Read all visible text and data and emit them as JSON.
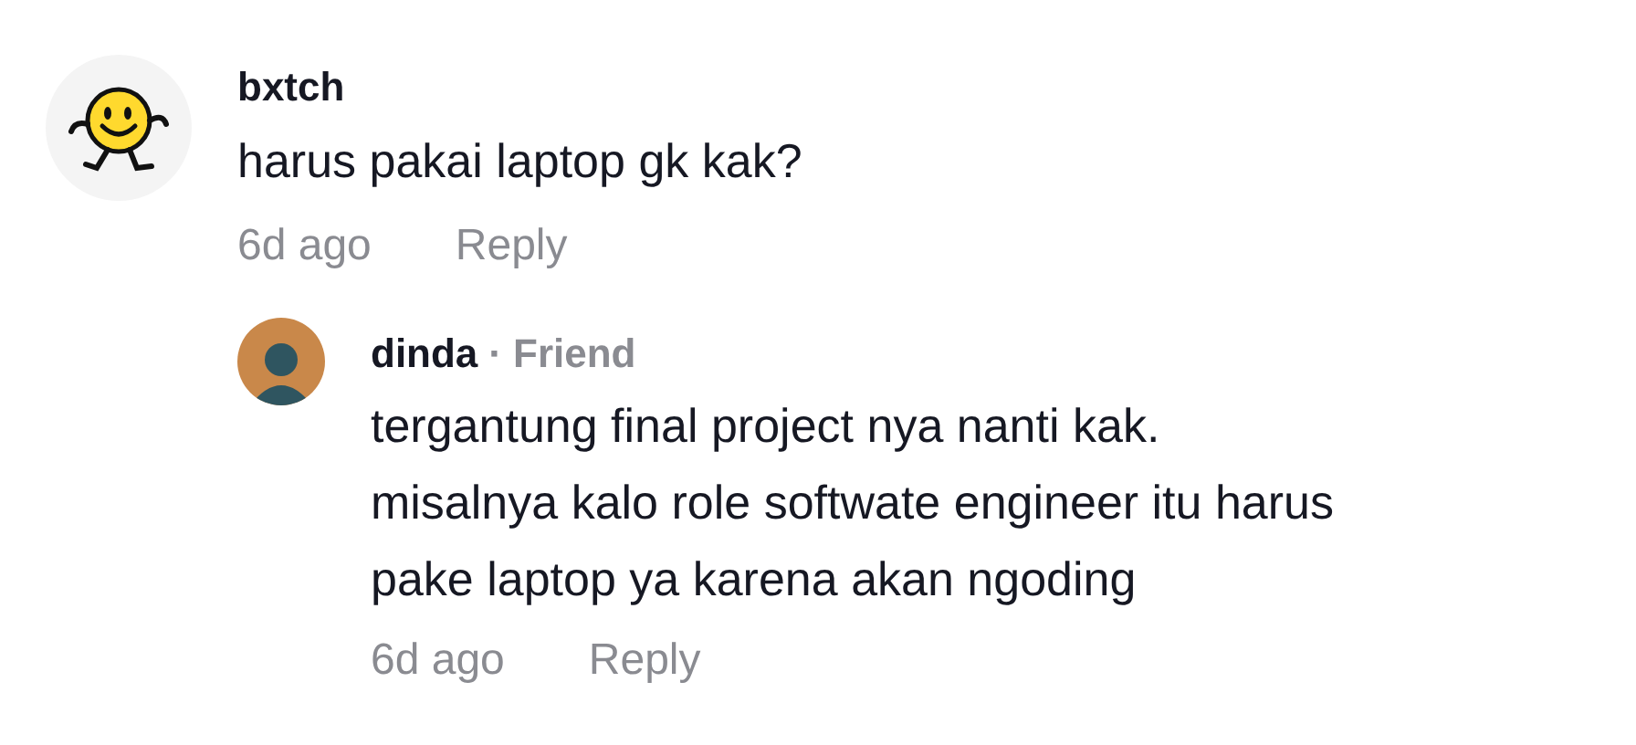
{
  "comments": [
    {
      "username": "bxtch",
      "text": "harus pakai laptop gk kak?",
      "time": "6d ago",
      "reply_label": "Reply",
      "replies": [
        {
          "username": "dinda",
          "separator": "·",
          "badge": "Friend",
          "text": "tergantung final project nya nanti kak.\nmisalnya kalo role softwate engineer itu harus\npake laptop ya karena akan ngoding",
          "time": "6d ago",
          "reply_label": "Reply"
        }
      ]
    }
  ]
}
